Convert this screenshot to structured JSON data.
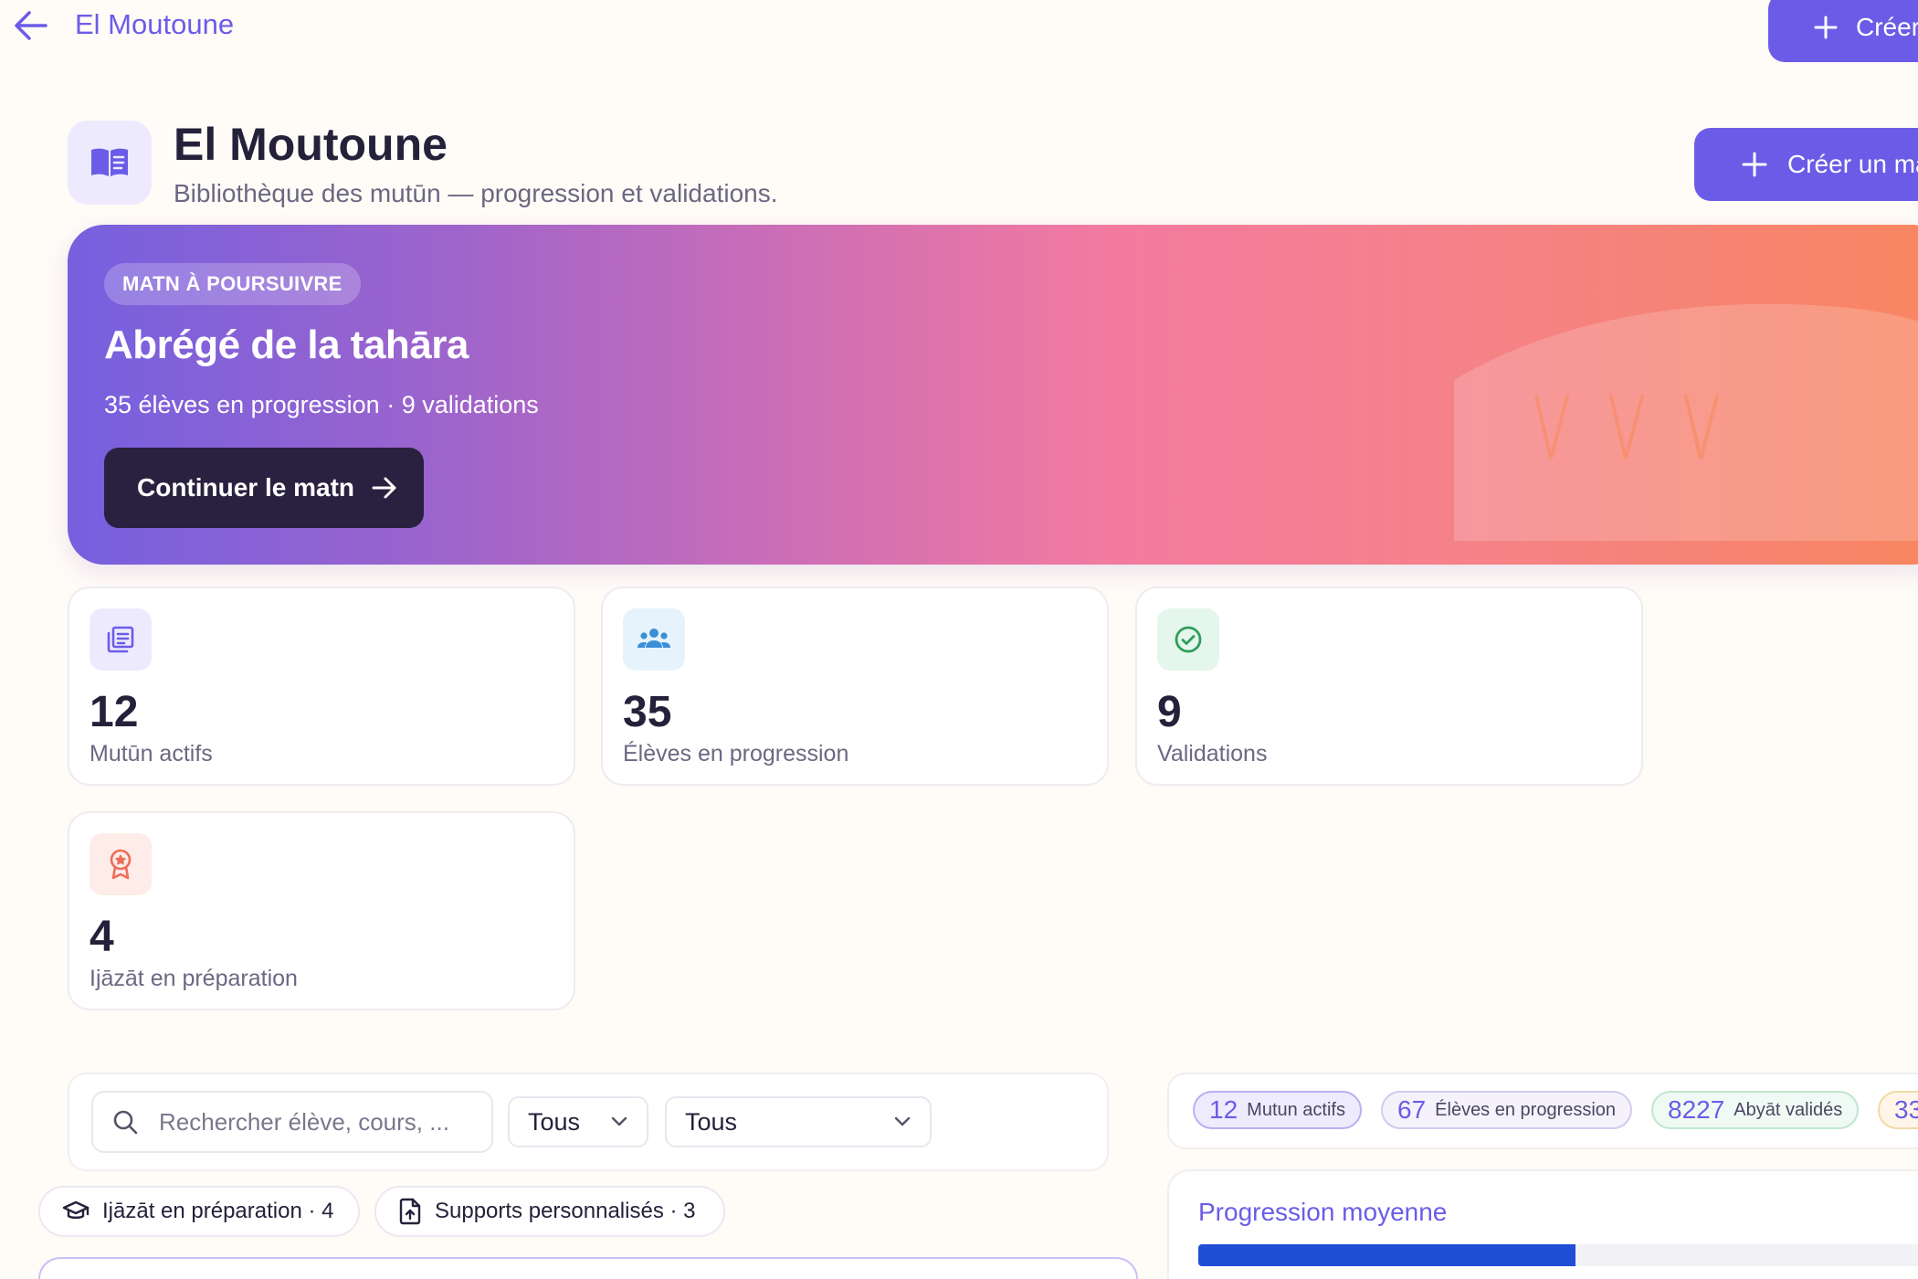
{
  "topbar": {
    "title": "El Moutoune",
    "create_label": "Créer"
  },
  "header": {
    "title": "El Moutoune",
    "subtitle": "Bibliothèque des mutūn — progression et validations.",
    "create_label": "Créer un ma"
  },
  "hero": {
    "badge": "MATN À POURSUIVRE",
    "title": "Abrégé de la tahāra",
    "meta": "35 élèves en progression · 9 validations",
    "button_label": "Continuer le matn"
  },
  "stats": [
    {
      "value": "12",
      "label": "Mutūn actifs",
      "icon": "book-stack-icon",
      "color": "#6b5ce7",
      "bg": "#eeeafe"
    },
    {
      "value": "35",
      "label": "Élèves en progression",
      "icon": "users-icon",
      "color": "#3b8fd6",
      "bg": "#e6f3fc"
    },
    {
      "value": "9",
      "label": "Validations",
      "icon": "check-circle-icon",
      "color": "#2e9e5b",
      "bg": "#e5f6ec"
    },
    {
      "value": "4",
      "label": "Ijāzāt en préparation",
      "icon": "award-icon",
      "color": "#ee6d58",
      "bg": "#fdece8"
    }
  ],
  "filters": {
    "search_placeholder": "Rechercher élève, cours, ...",
    "select1": "Tous",
    "select2": "Tous"
  },
  "chips": [
    {
      "label": "Ijāzāt en préparation · 4",
      "icon": "graduation-cap-icon"
    },
    {
      "label": "Supports personnalisés · 3",
      "icon": "file-upload-icon"
    }
  ],
  "summary": [
    {
      "value": "12",
      "label": "Mutun actifs",
      "color": "#6b5ce7",
      "bg": "#eeebfd",
      "border": "#b9b0f2"
    },
    {
      "value": "67",
      "label": "Élèves en progression",
      "color": "#6b5ce7",
      "bg": "#f5f2fc",
      "border": "#d2cbef"
    },
    {
      "value": "8227",
      "label": "Abyāt validés",
      "color": "#6b5ce7",
      "bg": "#f0faf4",
      "border": "#bfe6cf"
    },
    {
      "value": "33",
      "label": "",
      "color": "#6b5ce7",
      "bg": "#fff6e9",
      "border": "#f3d9a8"
    }
  ],
  "progress": {
    "title": "Progression moyenne",
    "value": 0.48
  }
}
